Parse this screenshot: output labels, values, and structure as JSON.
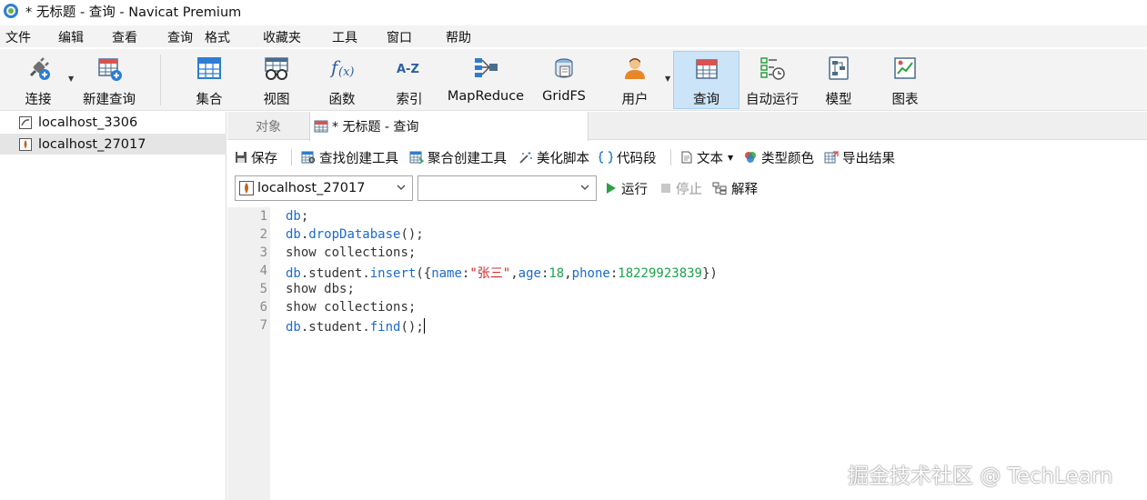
{
  "window": {
    "title": "* 无标题 - 查询 - Navicat Premium"
  },
  "menu": [
    "文件",
    "编辑",
    "查看",
    "查询",
    "格式",
    "收藏夹",
    "工具",
    "窗口",
    "帮助"
  ],
  "toolbar": {
    "connect": "连接",
    "new_query": "新建查询",
    "collection": "集合",
    "view": "视图",
    "function": "函数",
    "index": "索引",
    "mapreduce": "MapReduce",
    "gridfs": "GridFS",
    "user": "用户",
    "query": "查询",
    "automation": "自动运行",
    "model": "模型",
    "chart": "图表"
  },
  "sidebar": {
    "connections": [
      {
        "label": "localhost_3306",
        "icon": "mysql-connection-icon"
      },
      {
        "label": "localhost_27017",
        "icon": "mongodb-connection-icon"
      }
    ]
  },
  "tabs": {
    "objects": "对象",
    "query": "* 无标题 - 查询"
  },
  "query_toolbar": {
    "save": "保存",
    "find_builder": "查找创建工具",
    "aggregate_builder": "聚合创建工具",
    "beautify": "美化脚本",
    "snippet": "代码段",
    "text": "文本",
    "type_color": "类型颜色",
    "export": "导出结果"
  },
  "run_bar": {
    "connection_value": "localhost_27017",
    "database_value": "",
    "run": "运行",
    "stop": "停止",
    "explain": "解释"
  },
  "editor": {
    "line_numbers": [
      "1",
      "2",
      "3",
      "4",
      "5",
      "6",
      "7"
    ],
    "lines": [
      "db;",
      "db.dropDatabase();",
      "show collections;",
      "db.student.insert({name:\"张三\",age:18,phone:18229923839})",
      "show dbs;",
      "show collections;",
      "db.student.find();"
    ]
  },
  "watermark": "掘金技术社区 @ TechLearn",
  "colors": {
    "accent_blue": "#1a6bd0",
    "string_red": "#d02a2a",
    "number_green": "#1aa34a",
    "run_green": "#2ea043",
    "active_tool_bg": "#cce4f7"
  }
}
